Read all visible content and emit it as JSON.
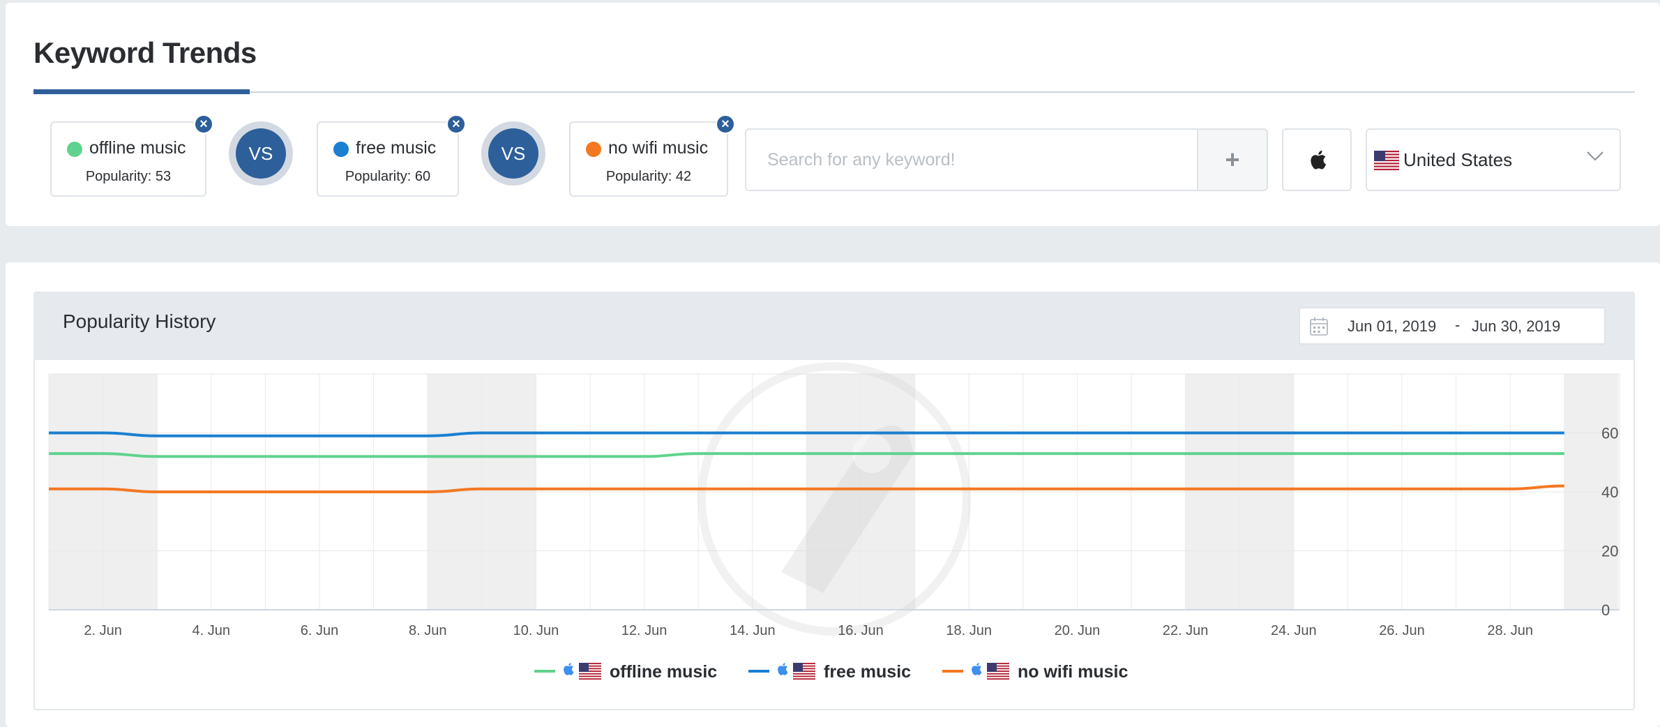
{
  "page": {
    "title": "Keyword Trends"
  },
  "keywords": [
    {
      "name": "offline music",
      "popularity": "Popularity: 53",
      "color": "#5fd38d"
    },
    {
      "name": "free music",
      "popularity": "Popularity: 60",
      "color": "#1a7fd1"
    },
    {
      "name": "no wifi music",
      "popularity": "Popularity: 42",
      "color": "#f47721"
    }
  ],
  "vs_label": "VS",
  "search": {
    "placeholder": "Search for any keyword!",
    "add_icon": "plus-icon"
  },
  "platform": {
    "icon": "apple-icon"
  },
  "country": {
    "selected": "United States",
    "flag": "us-flag-icon"
  },
  "history": {
    "title": "Popularity History",
    "date_from": "Jun 01, 2019",
    "date_separator": "-",
    "date_to": "Jun 30, 2019"
  },
  "chart_data": {
    "type": "line",
    "x_label_dates": [
      "2. Jun",
      "4. Jun",
      "6. Jun",
      "8. Jun",
      "10. Jun",
      "12. Jun",
      "14. Jun",
      "16. Jun",
      "18. Jun",
      "20. Jun",
      "22. Jun",
      "24. Jun",
      "26. Jun",
      "28. Jun"
    ],
    "xlim": [
      "1. Jun",
      "30. Jun"
    ],
    "ylim": [
      0,
      80
    ],
    "yticks": [
      0,
      20,
      40,
      60
    ],
    "weekend_bands": [
      [
        "1. Jun",
        "3. Jun"
      ],
      [
        "8. Jun",
        "10. Jun"
      ],
      [
        "15. Jun",
        "17. Jun"
      ],
      [
        "22. Jun",
        "24. Jun"
      ],
      [
        "29. Jun",
        "30. Jun"
      ]
    ],
    "series": [
      {
        "name": "offline music",
        "color": "#5fd38d",
        "x": [
          "1. Jun",
          "2. Jun",
          "3. Jun",
          "4. Jun",
          "5. Jun",
          "6. Jun",
          "7. Jun",
          "8. Jun",
          "9. Jun",
          "10. Jun",
          "11. Jun",
          "12. Jun",
          "13. Jun",
          "14. Jun",
          "15. Jun",
          "16. Jun",
          "17. Jun",
          "18. Jun",
          "19. Jun",
          "20. Jun",
          "21. Jun",
          "22. Jun",
          "23. Jun",
          "24. Jun",
          "25. Jun",
          "26. Jun",
          "27. Jun",
          "28. Jun",
          "29. Jun"
        ],
        "values": [
          53,
          53,
          52,
          52,
          52,
          52,
          52,
          52,
          52,
          52,
          52,
          52,
          53,
          53,
          53,
          53,
          53,
          53,
          53,
          53,
          53,
          53,
          53,
          53,
          53,
          53,
          53,
          53,
          53
        ]
      },
      {
        "name": "free music",
        "color": "#1a7fd1",
        "x": [
          "1. Jun",
          "2. Jun",
          "3. Jun",
          "4. Jun",
          "5. Jun",
          "6. Jun",
          "7. Jun",
          "8. Jun",
          "9. Jun",
          "10. Jun",
          "11. Jun",
          "12. Jun",
          "13. Jun",
          "14. Jun",
          "15. Jun",
          "16. Jun",
          "17. Jun",
          "18. Jun",
          "19. Jun",
          "20. Jun",
          "21. Jun",
          "22. Jun",
          "23. Jun",
          "24. Jun",
          "25. Jun",
          "26. Jun",
          "27. Jun",
          "28. Jun",
          "29. Jun"
        ],
        "values": [
          60,
          60,
          59,
          59,
          59,
          59,
          59,
          59,
          60,
          60,
          60,
          60,
          60,
          60,
          60,
          60,
          60,
          60,
          60,
          60,
          60,
          60,
          60,
          60,
          60,
          60,
          60,
          60,
          60
        ]
      },
      {
        "name": "no wifi music",
        "color": "#f47721",
        "x": [
          "1. Jun",
          "2. Jun",
          "3. Jun",
          "4. Jun",
          "5. Jun",
          "6. Jun",
          "7. Jun",
          "8. Jun",
          "9. Jun",
          "10. Jun",
          "11. Jun",
          "12. Jun",
          "13. Jun",
          "14. Jun",
          "15. Jun",
          "16. Jun",
          "17. Jun",
          "18. Jun",
          "19. Jun",
          "20. Jun",
          "21. Jun",
          "22. Jun",
          "23. Jun",
          "24. Jun",
          "25. Jun",
          "26. Jun",
          "27. Jun",
          "28. Jun",
          "29. Jun"
        ],
        "values": [
          41,
          41,
          40,
          40,
          40,
          40,
          40,
          40,
          41,
          41,
          41,
          41,
          41,
          41,
          41,
          41,
          41,
          41,
          41,
          41,
          41,
          41,
          41,
          41,
          41,
          41,
          41,
          41,
          42
        ]
      }
    ],
    "legend": {
      "placement": "bottom-center",
      "icons": [
        "apple-icon",
        "us-flag-icon"
      ]
    }
  }
}
